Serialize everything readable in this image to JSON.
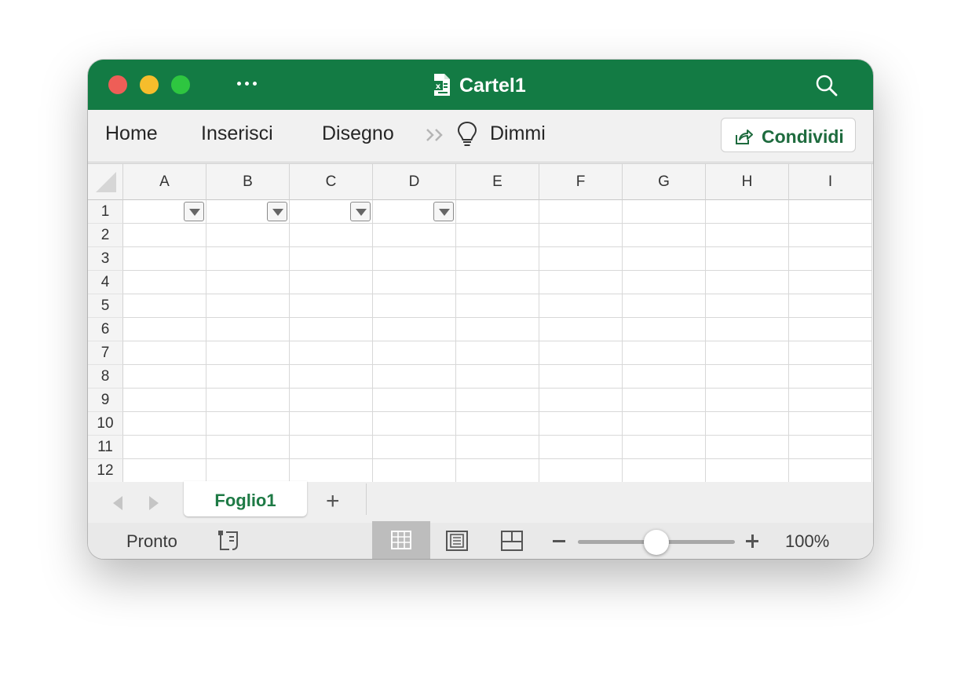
{
  "window": {
    "title": "Cartel1",
    "accent_color": "#137b44",
    "icons": [
      "more-icon",
      "excel-doc-icon",
      "search-icon"
    ]
  },
  "ribbon": {
    "tabs": [
      "Home",
      "Inserisci",
      "Disegno"
    ],
    "overflow_icon": "double-chevron-icon",
    "tell_me_label": "Dimmi",
    "share_label": "Condividi"
  },
  "grid": {
    "columns": [
      "A",
      "B",
      "C",
      "D",
      "E",
      "F",
      "G",
      "H",
      "I"
    ],
    "rows": [
      "1",
      "2",
      "3",
      "4",
      "5",
      "6",
      "7",
      "8",
      "9",
      "10",
      "11",
      "12"
    ],
    "filter_columns": [
      "A",
      "B",
      "C",
      "D"
    ]
  },
  "sheets": {
    "tabs": [
      "Foglio1"
    ],
    "active": "Foglio1",
    "add_label": "+"
  },
  "status": {
    "ready_text": "Pronto",
    "zoom_minus": "−",
    "zoom_percent": "100%",
    "zoom_value": 100,
    "zoom_slider_fraction": 0.5,
    "active_view": "normal"
  }
}
